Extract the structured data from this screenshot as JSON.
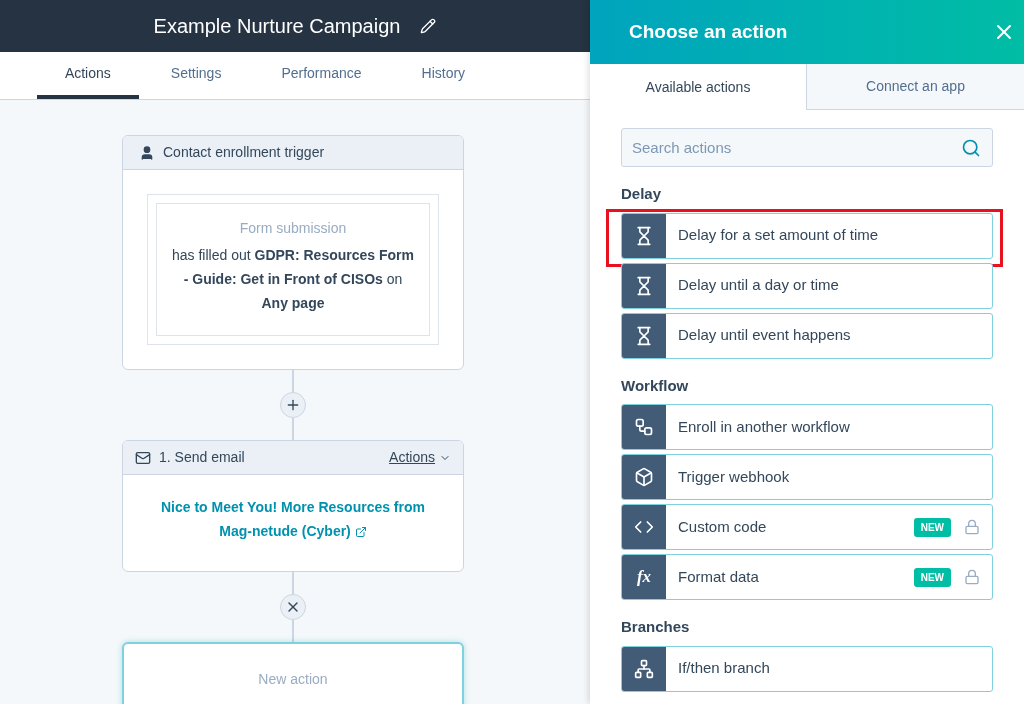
{
  "header": {
    "title": "Example Nurture Campaign"
  },
  "tabs": [
    {
      "label": "Actions",
      "selected": true
    },
    {
      "label": "Settings",
      "selected": false
    },
    {
      "label": "Performance",
      "selected": false
    },
    {
      "label": "History",
      "selected": false
    }
  ],
  "trigger": {
    "title": "Contact enrollment trigger",
    "filter_type": "Form submission",
    "filter_text": "has filled out **GDPR: Resources Form - Guide: Get in Front of CISOs** on **Any page**"
  },
  "email_action": {
    "title": "1. Send email",
    "menu": "Actions",
    "link": "Nice to Meet You! More Resources from Mag-netude (Cyber)"
  },
  "new_action": {
    "label": "New action"
  },
  "panel": {
    "title": "Choose an action",
    "tabs": [
      {
        "label": "Available actions",
        "selected": true
      },
      {
        "label": "Connect an app",
        "selected": false
      }
    ],
    "search": {
      "placeholder": "Search actions"
    },
    "sections": [
      {
        "heading": "Delay",
        "items": [
          {
            "label": "Delay for a set amount of time",
            "kind": "hourglass",
            "highlighted": true,
            "locked": false
          },
          {
            "label": "Delay until a day or time",
            "kind": "hourglass",
            "highlighted": false,
            "locked": false
          },
          {
            "label": "Delay until event happens",
            "kind": "hourglass",
            "highlighted": false,
            "locked": false
          }
        ]
      },
      {
        "heading": "Workflow",
        "items": [
          {
            "label": "Enroll in another workflow",
            "kind": "workflow",
            "highlighted": false,
            "locked": false
          },
          {
            "label": "Trigger webhook",
            "kind": "cube",
            "highlighted": false,
            "locked": false
          },
          {
            "label": "Custom code",
            "kind": "code",
            "badge": "NEW",
            "highlighted": false,
            "locked": true
          },
          {
            "label": "Format data",
            "kind": "fx",
            "glyph": "fx",
            "badge": "NEW",
            "highlighted": false,
            "locked": true
          }
        ]
      },
      {
        "heading": "Branches",
        "items": [
          {
            "label": "If/then branch",
            "kind": "branch",
            "highlighted": false,
            "locked": false
          }
        ]
      }
    ]
  }
}
